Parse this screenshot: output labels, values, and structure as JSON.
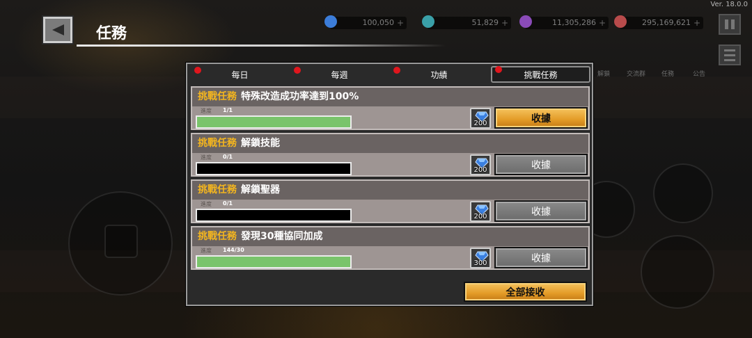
{
  "header": {
    "title": "任務",
    "version": "Ver. 18.0.0"
  },
  "currencies": [
    {
      "icon": "gem-icon",
      "value": "100,050",
      "color": "#3c7dd9"
    },
    {
      "icon": "coin-icon",
      "value": "51,829",
      "color": "#3aa0a8"
    },
    {
      "icon": "crystal-icon",
      "value": "11,305,286",
      "color": "#8a4bb8"
    },
    {
      "icon": "orb-icon",
      "value": "295,169,621",
      "color": "#b84b4b"
    }
  ],
  "bg_menu": {
    "items": [
      "解鎖",
      "交流群",
      "任務",
      "公告"
    ]
  },
  "tabs": [
    {
      "label": "每日",
      "has_dot": true,
      "active": false
    },
    {
      "label": "每週",
      "has_dot": true,
      "active": false
    },
    {
      "label": "功績",
      "has_dot": true,
      "active": false
    },
    {
      "label": "挑戰任務",
      "has_dot": true,
      "active": true
    }
  ],
  "progress_label": "進度",
  "missions": [
    {
      "tag": "挑戰任務",
      "name": "特殊改造成功率達到100%",
      "progress": "1/1",
      "fill": 1.0,
      "reward": "200",
      "claim_label": "收據",
      "claimable": true
    },
    {
      "tag": "挑戰任務",
      "name": "解鎖技能",
      "progress": "0/1",
      "fill": 0.0,
      "reward": "200",
      "claim_label": "收據",
      "claimable": false
    },
    {
      "tag": "挑戰任務",
      "name": "解鎖聖器",
      "progress": "0/1",
      "fill": 0.0,
      "reward": "200",
      "claim_label": "收據",
      "claimable": false
    },
    {
      "tag": "挑戰任務",
      "name": "發現30種協同加成",
      "progress": "144/30",
      "fill": 1.0,
      "reward": "300",
      "claim_label": "收據",
      "claimable": false
    }
  ],
  "claim_all_label": "全部接收",
  "colors": {
    "accent_gold": "#f3b51f",
    "progress_green": "#7ac46b",
    "notification_red": "#e0161d"
  }
}
